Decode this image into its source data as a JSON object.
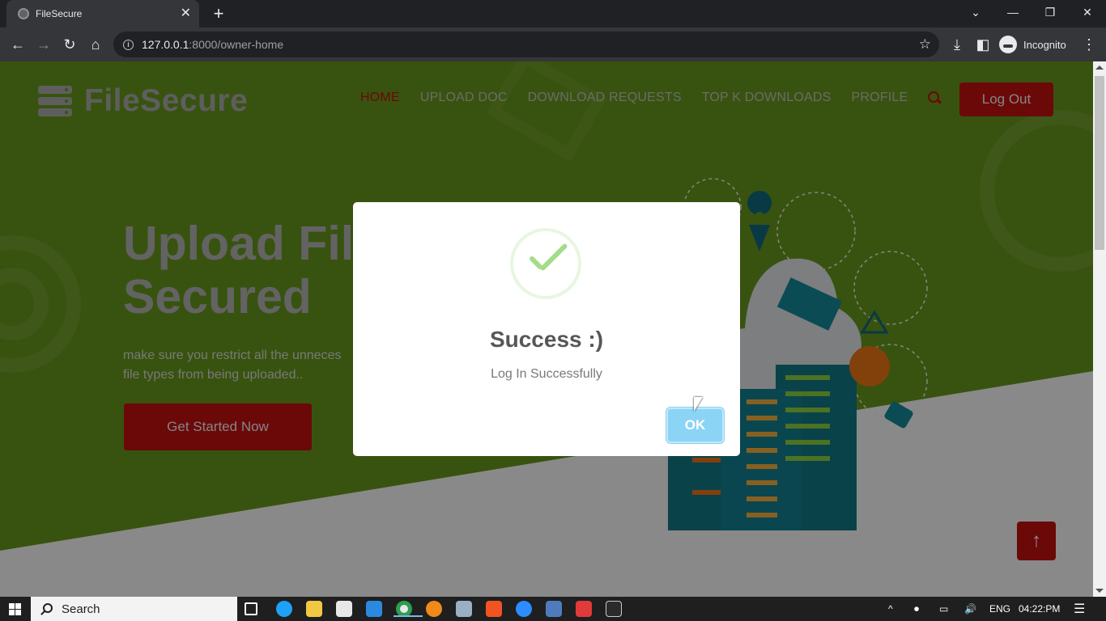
{
  "browser": {
    "tab_title": "FileSecure",
    "tab_close": "✕",
    "new_tab": "+",
    "url_host": "127.0.0.1",
    "url_path": ":8000/owner-home",
    "incognito_label": "Incognito",
    "window_controls": [
      "⌄",
      "—",
      "❐",
      "✕"
    ],
    "nav_icons": [
      "←",
      "→",
      "↻",
      "⌂"
    ],
    "toolbar_icons": [
      "⤓",
      "◧",
      "⋮"
    ],
    "star": "☆"
  },
  "site": {
    "logo_text": "FileSecure",
    "nav": [
      "HOME",
      "UPLOAD DOC",
      "DOWNLOAD REQUESTS",
      "TOP K DOWNLOADS",
      "PROFILE"
    ],
    "active_nav": "HOME",
    "logout_label": "Log Out",
    "hero_title": "Upload Fil\nSecured",
    "hero_subtitle": "make sure you restrict all the unneces\nfile types from being uploaded..",
    "cta_label": "Get Started Now",
    "back_to_top": "↑"
  },
  "modal": {
    "title": "Success :)",
    "text": "Log In Successfully",
    "ok_label": "OK"
  },
  "taskbar": {
    "search_label": "Search",
    "lang": "ENG",
    "time": "04:22:PM",
    "tray_icons": [
      "^",
      "⏺",
      "▭",
      "🔊"
    ],
    "notification_icon": "☰"
  },
  "colors": {
    "page_green": "#5e8a19",
    "brand_red": "#b30f0f",
    "ok_blue": "#8cd4f5",
    "check_green": "#a5dc86"
  }
}
